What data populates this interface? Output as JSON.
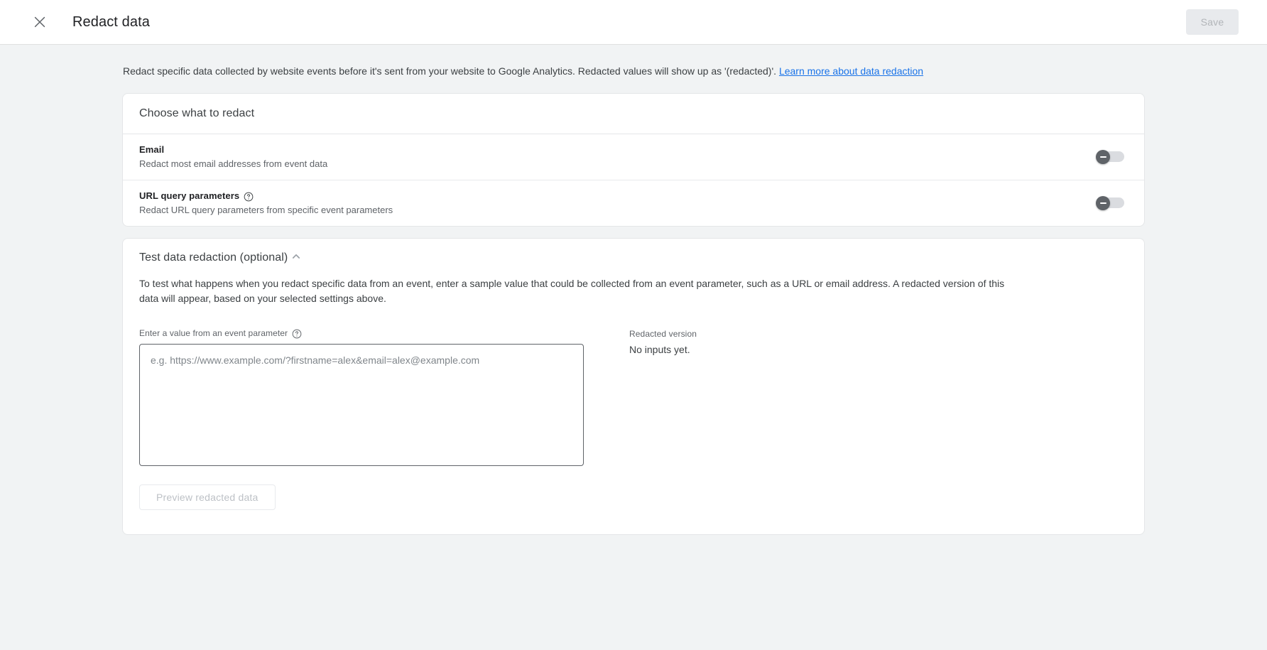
{
  "appbar": {
    "close_icon": "close-icon",
    "title": "Redact data",
    "save_label": "Save"
  },
  "intro": {
    "text_before_link": "Redact specific data collected by website events before it's sent from your website to Google Analytics. Redacted values will show up as '(redacted)'. ",
    "link_label": "Learn more about data redaction"
  },
  "choose_card": {
    "title": "Choose what to redact",
    "rows": [
      {
        "title": "Email",
        "subtitle": "Redact most email addresses from event data",
        "has_help_icon": false,
        "toggle_state": "off"
      },
      {
        "title": "URL query parameters",
        "subtitle": "Redact URL query parameters from specific event parameters",
        "has_help_icon": true,
        "help_icon": "help-icon",
        "toggle_state": "off"
      }
    ]
  },
  "test_card": {
    "title": "Test data redaction (optional)",
    "collapse_icon": "chevron-up-icon",
    "description": "To test what happens when you redact specific data from an event, enter a sample value that could be collected from an event parameter, such as a URL or email address. A redacted version of this data will appear, based on your selected settings above.",
    "input": {
      "label": "Enter a value from an event parameter",
      "help_icon": "help-icon",
      "placeholder": "e.g. https://www.example.com/?firstname=alex&email=alex@example.com",
      "value": ""
    },
    "preview_button_label": "Preview redacted data",
    "result": {
      "label": "Redacted version",
      "value": "No inputs yet."
    }
  },
  "colors": {
    "page_background": "#f1f3f4",
    "card_background": "#ffffff",
    "link": "#1a73e8",
    "toggle_knob_off": "#5f6368",
    "toggle_track_off": "#dadce0",
    "text_primary": "#202124",
    "text_secondary": "#5f6368"
  }
}
